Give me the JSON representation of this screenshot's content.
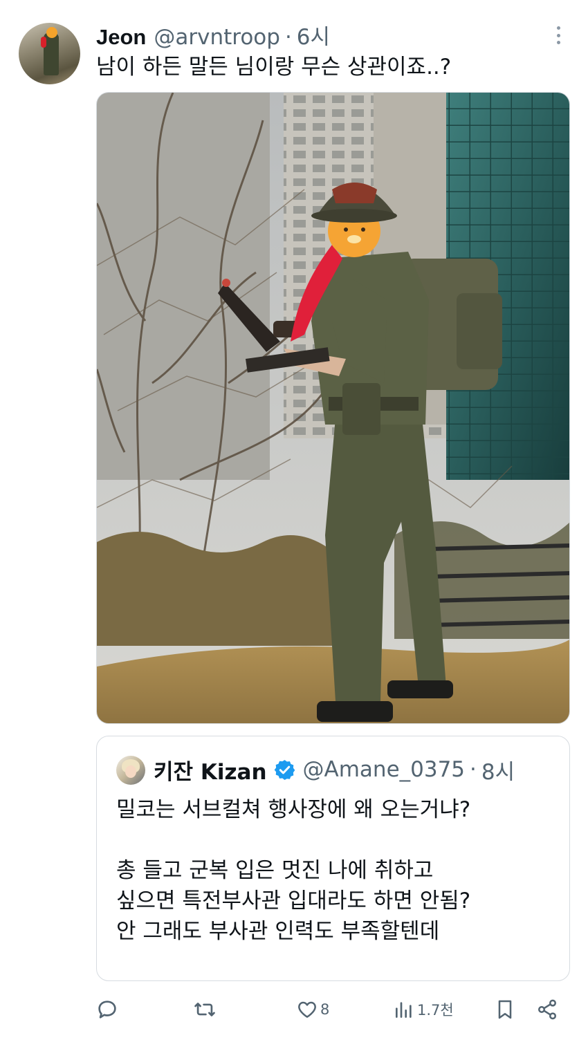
{
  "tweet": {
    "name": "Jeon",
    "handle": "@arvntroop",
    "separator": "·",
    "time": "6시",
    "text": "남이 하든 말든 님이랑 무슨 상관이죠..?"
  },
  "quote": {
    "name": "키잔 Kizan",
    "handle": "@Amane_0375",
    "separator": "·",
    "time": "8시",
    "text": "밀코는 서브컬쳐 행사장에 왜 오는거냐?\n\n총 들고 군복 입은 멋진 나에 취하고\n싶으면 특전부사관 입대라도 하면 안됨?\n안 그래도 부사관 인력도 부족할텐데"
  },
  "actions": {
    "reply_icon": "reply-icon",
    "retweet_icon": "retweet-icon",
    "like_icon": "heart-icon",
    "like_count": "8",
    "views_icon": "views-icon",
    "views_count": "1.7천",
    "bookmark_icon": "bookmark-icon",
    "share_icon": "share-icon"
  },
  "colors": {
    "secondary_text": "#536471",
    "verified_blue": "#1d9bf0",
    "border": "#d6dbe0"
  }
}
